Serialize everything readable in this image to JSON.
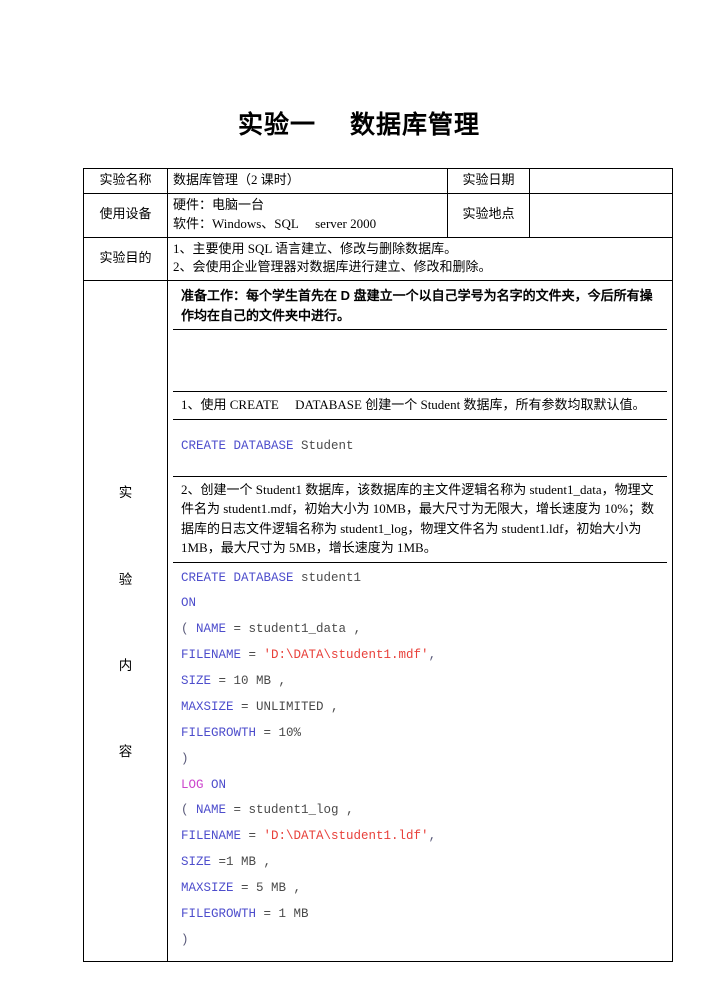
{
  "document": {
    "title": "实验一  数据库管理"
  },
  "info_table": {
    "rows": [
      {
        "label": "实验名称",
        "value": "数据库管理（2 课时）",
        "label2": "实验日期",
        "value2": ""
      },
      {
        "label": "使用设备",
        "value_lines": [
          "硬件：电脑一台",
          "软件：Windows、SQL  server 2000"
        ],
        "label2": "实验地点",
        "value2": ""
      },
      {
        "label": "实验目的",
        "value_lines": [
          "1、主要使用 SQL 语言建立、修改与删除数据库。",
          "2、会使用企业管理器对数据库进行建立、修改和删除。"
        ]
      }
    ]
  },
  "content_section": {
    "vertical_label": [
      "实",
      "验",
      "内",
      "容"
    ],
    "blocks": {
      "preparation": "准备工作：每个学生首先在 D 盘建立一个以自己学号为名字的文件夹，今后所有操作均在自己的文件夹中进行。",
      "task1": "1、使用 CREATE  DATABASE 创建一个 Student 数据库，所有参数均取默认值。",
      "task2": "2、创建一个 Student1 数据库，该数据库的主文件逻辑名称为 student1_data，物理文件名为 student1.mdf，初始大小为 10MB，最大尺寸为无限大，增长速度为 10%；数据库的日志文件逻辑名称为 student1_log，物理文件名为 student1.ldf，初始大小为 1MB，最大尺寸为 5MB，增长速度为 1MB。"
    },
    "code1": {
      "lines": [
        [
          {
            "t": "CREATE DATABASE ",
            "c": "kw"
          },
          {
            "t": "Student",
            "c": "idn"
          }
        ]
      ]
    },
    "code2": {
      "lines": [
        [
          {
            "t": "CREATE DATABASE ",
            "c": "kw"
          },
          {
            "t": "student1",
            "c": "idn"
          }
        ],
        [
          {
            "t": "ON",
            "c": "kw"
          }
        ],
        [
          {
            "t": "( ",
            "c": "pun"
          },
          {
            "t": "NAME",
            "c": "kw"
          },
          {
            "t": " = ",
            "c": "idn"
          },
          {
            "t": "student1_data ,",
            "c": "idn"
          }
        ],
        [
          {
            "t": "FILENAME",
            "c": "kw"
          },
          {
            "t": " = ",
            "c": "idn"
          },
          {
            "t": "'D:\\DATA\\student1.mdf'",
            "c": "str"
          },
          {
            "t": ",",
            "c": "pun"
          }
        ],
        [
          {
            "t": "SIZE",
            "c": "kw"
          },
          {
            "t": " = 10 MB ,",
            "c": "idn"
          }
        ],
        [
          {
            "t": "MAXSIZE",
            "c": "kw"
          },
          {
            "t": " = UNLIMITED ,",
            "c": "idn"
          }
        ],
        [
          {
            "t": "FILEGROWTH",
            "c": "kw"
          },
          {
            "t": " = 10%",
            "c": "idn"
          }
        ],
        [
          {
            "t": ")",
            "c": "pun"
          }
        ],
        [
          {
            "t": "LOG ",
            "c": "kw2"
          },
          {
            "t": "ON",
            "c": "kw"
          }
        ],
        [
          {
            "t": "( ",
            "c": "pun"
          },
          {
            "t": "NAME",
            "c": "kw"
          },
          {
            "t": " = ",
            "c": "idn"
          },
          {
            "t": "student1_log ,",
            "c": "idn"
          }
        ],
        [
          {
            "t": "FILENAME",
            "c": "kw"
          },
          {
            "t": " = ",
            "c": "idn"
          },
          {
            "t": "'D:\\DATA\\student1.ldf'",
            "c": "str"
          },
          {
            "t": ",",
            "c": "pun"
          }
        ],
        [
          {
            "t": "SIZE",
            "c": "kw"
          },
          {
            "t": " =1 MB ,",
            "c": "idn"
          }
        ],
        [
          {
            "t": "MAXSIZE",
            "c": "kw"
          },
          {
            "t": " = 5 MB ,",
            "c": "idn"
          }
        ],
        [
          {
            "t": "FILEGROWTH",
            "c": "kw"
          },
          {
            "t": " = 1 MB",
            "c": "idn"
          }
        ],
        [
          {
            "t": ")",
            "c": "pun"
          }
        ]
      ]
    }
  },
  "colors": {
    "keyword": "#4d4dcc",
    "keyword_alt": "#cc44cc",
    "string": "#e8403a",
    "identifier": "#4a4a4a",
    "border": "#000000",
    "text": "#000000",
    "background": "#ffffff"
  }
}
